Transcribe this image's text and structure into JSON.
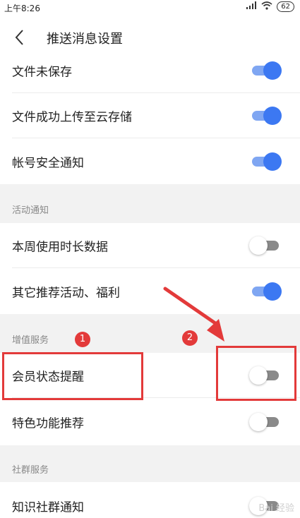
{
  "status_bar": {
    "time": "上午8:26",
    "signal": "HD",
    "battery": "62"
  },
  "header": {
    "title": "推送消息设置"
  },
  "rows_top": [
    {
      "label": "文件未保存",
      "on": true
    },
    {
      "label": "文件成功上传至云存储",
      "on": true
    },
    {
      "label": "帐号安全通知",
      "on": true
    }
  ],
  "sections": [
    {
      "title": "活动通知",
      "items": [
        {
          "label": "本周使用时长数据",
          "on": false
        },
        {
          "label": "其它推荐活动、福利",
          "on": true
        }
      ]
    },
    {
      "title": "增值服务",
      "items": [
        {
          "label": "会员状态提醒",
          "on": false
        },
        {
          "label": "特色功能推荐",
          "on": false
        }
      ]
    },
    {
      "title": "社群服务",
      "items": [
        {
          "label": "知识社群通知",
          "on": false
        }
      ]
    }
  ],
  "annotations": {
    "badge_1": "1",
    "badge_2": "2"
  },
  "watermark": "Bai 经验",
  "colors": {
    "toggle_on": "#3c78f2",
    "toggle_on_track": "#7fa6f2",
    "toggle_off_track": "#8a8a8a",
    "annotation": "#e33a3a",
    "section_bg": "#f2f2f2"
  }
}
